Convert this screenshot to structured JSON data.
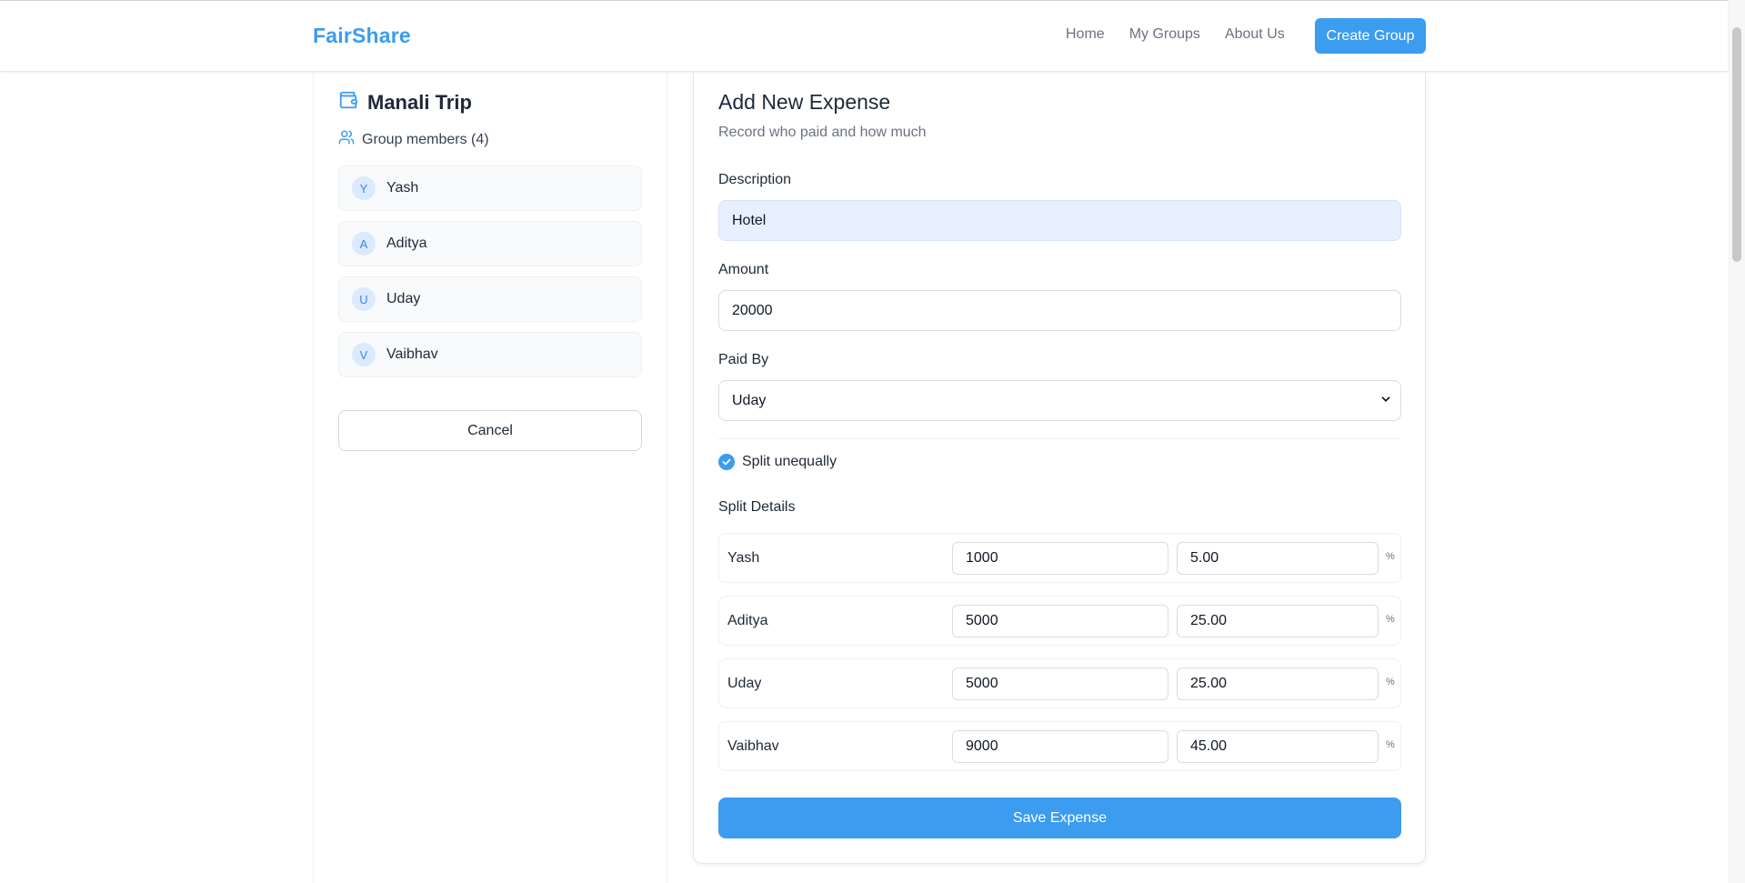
{
  "header": {
    "logo": "FairShare",
    "nav": [
      "Home",
      "My Groups",
      "About Us"
    ],
    "create_button": "Create Group"
  },
  "group": {
    "name": "Manali Trip",
    "members_label": "Group members (4)",
    "members": [
      {
        "initial": "Y",
        "name": "Yash"
      },
      {
        "initial": "A",
        "name": "Aditya"
      },
      {
        "initial": "U",
        "name": "Uday"
      },
      {
        "initial": "V",
        "name": "Vaibhav"
      }
    ],
    "cancel_label": "Cancel"
  },
  "form": {
    "title": "Add New Expense",
    "subtitle": "Record who paid and how much",
    "description_label": "Description",
    "description_value": "Hotel",
    "amount_label": "Amount",
    "amount_value": "20000",
    "paid_by_label": "Paid By",
    "paid_by_value": "Uday",
    "split_checkbox_label": "Split unequally",
    "split_checked": true,
    "split_details_label": "Split Details",
    "splits": [
      {
        "name": "Yash",
        "amount": "1000",
        "percent": "5.00"
      },
      {
        "name": "Aditya",
        "amount": "5000",
        "percent": "25.00"
      },
      {
        "name": "Uday",
        "amount": "5000",
        "percent": "25.00"
      },
      {
        "name": "Vaibhav",
        "amount": "9000",
        "percent": "45.00"
      }
    ],
    "percent_sign": "%",
    "save_label": "Save Expense"
  },
  "colors": {
    "accent": "#3b9cf0",
    "avatar_bg": "#dbeafe",
    "filled_input_bg": "#e8f0fe"
  }
}
